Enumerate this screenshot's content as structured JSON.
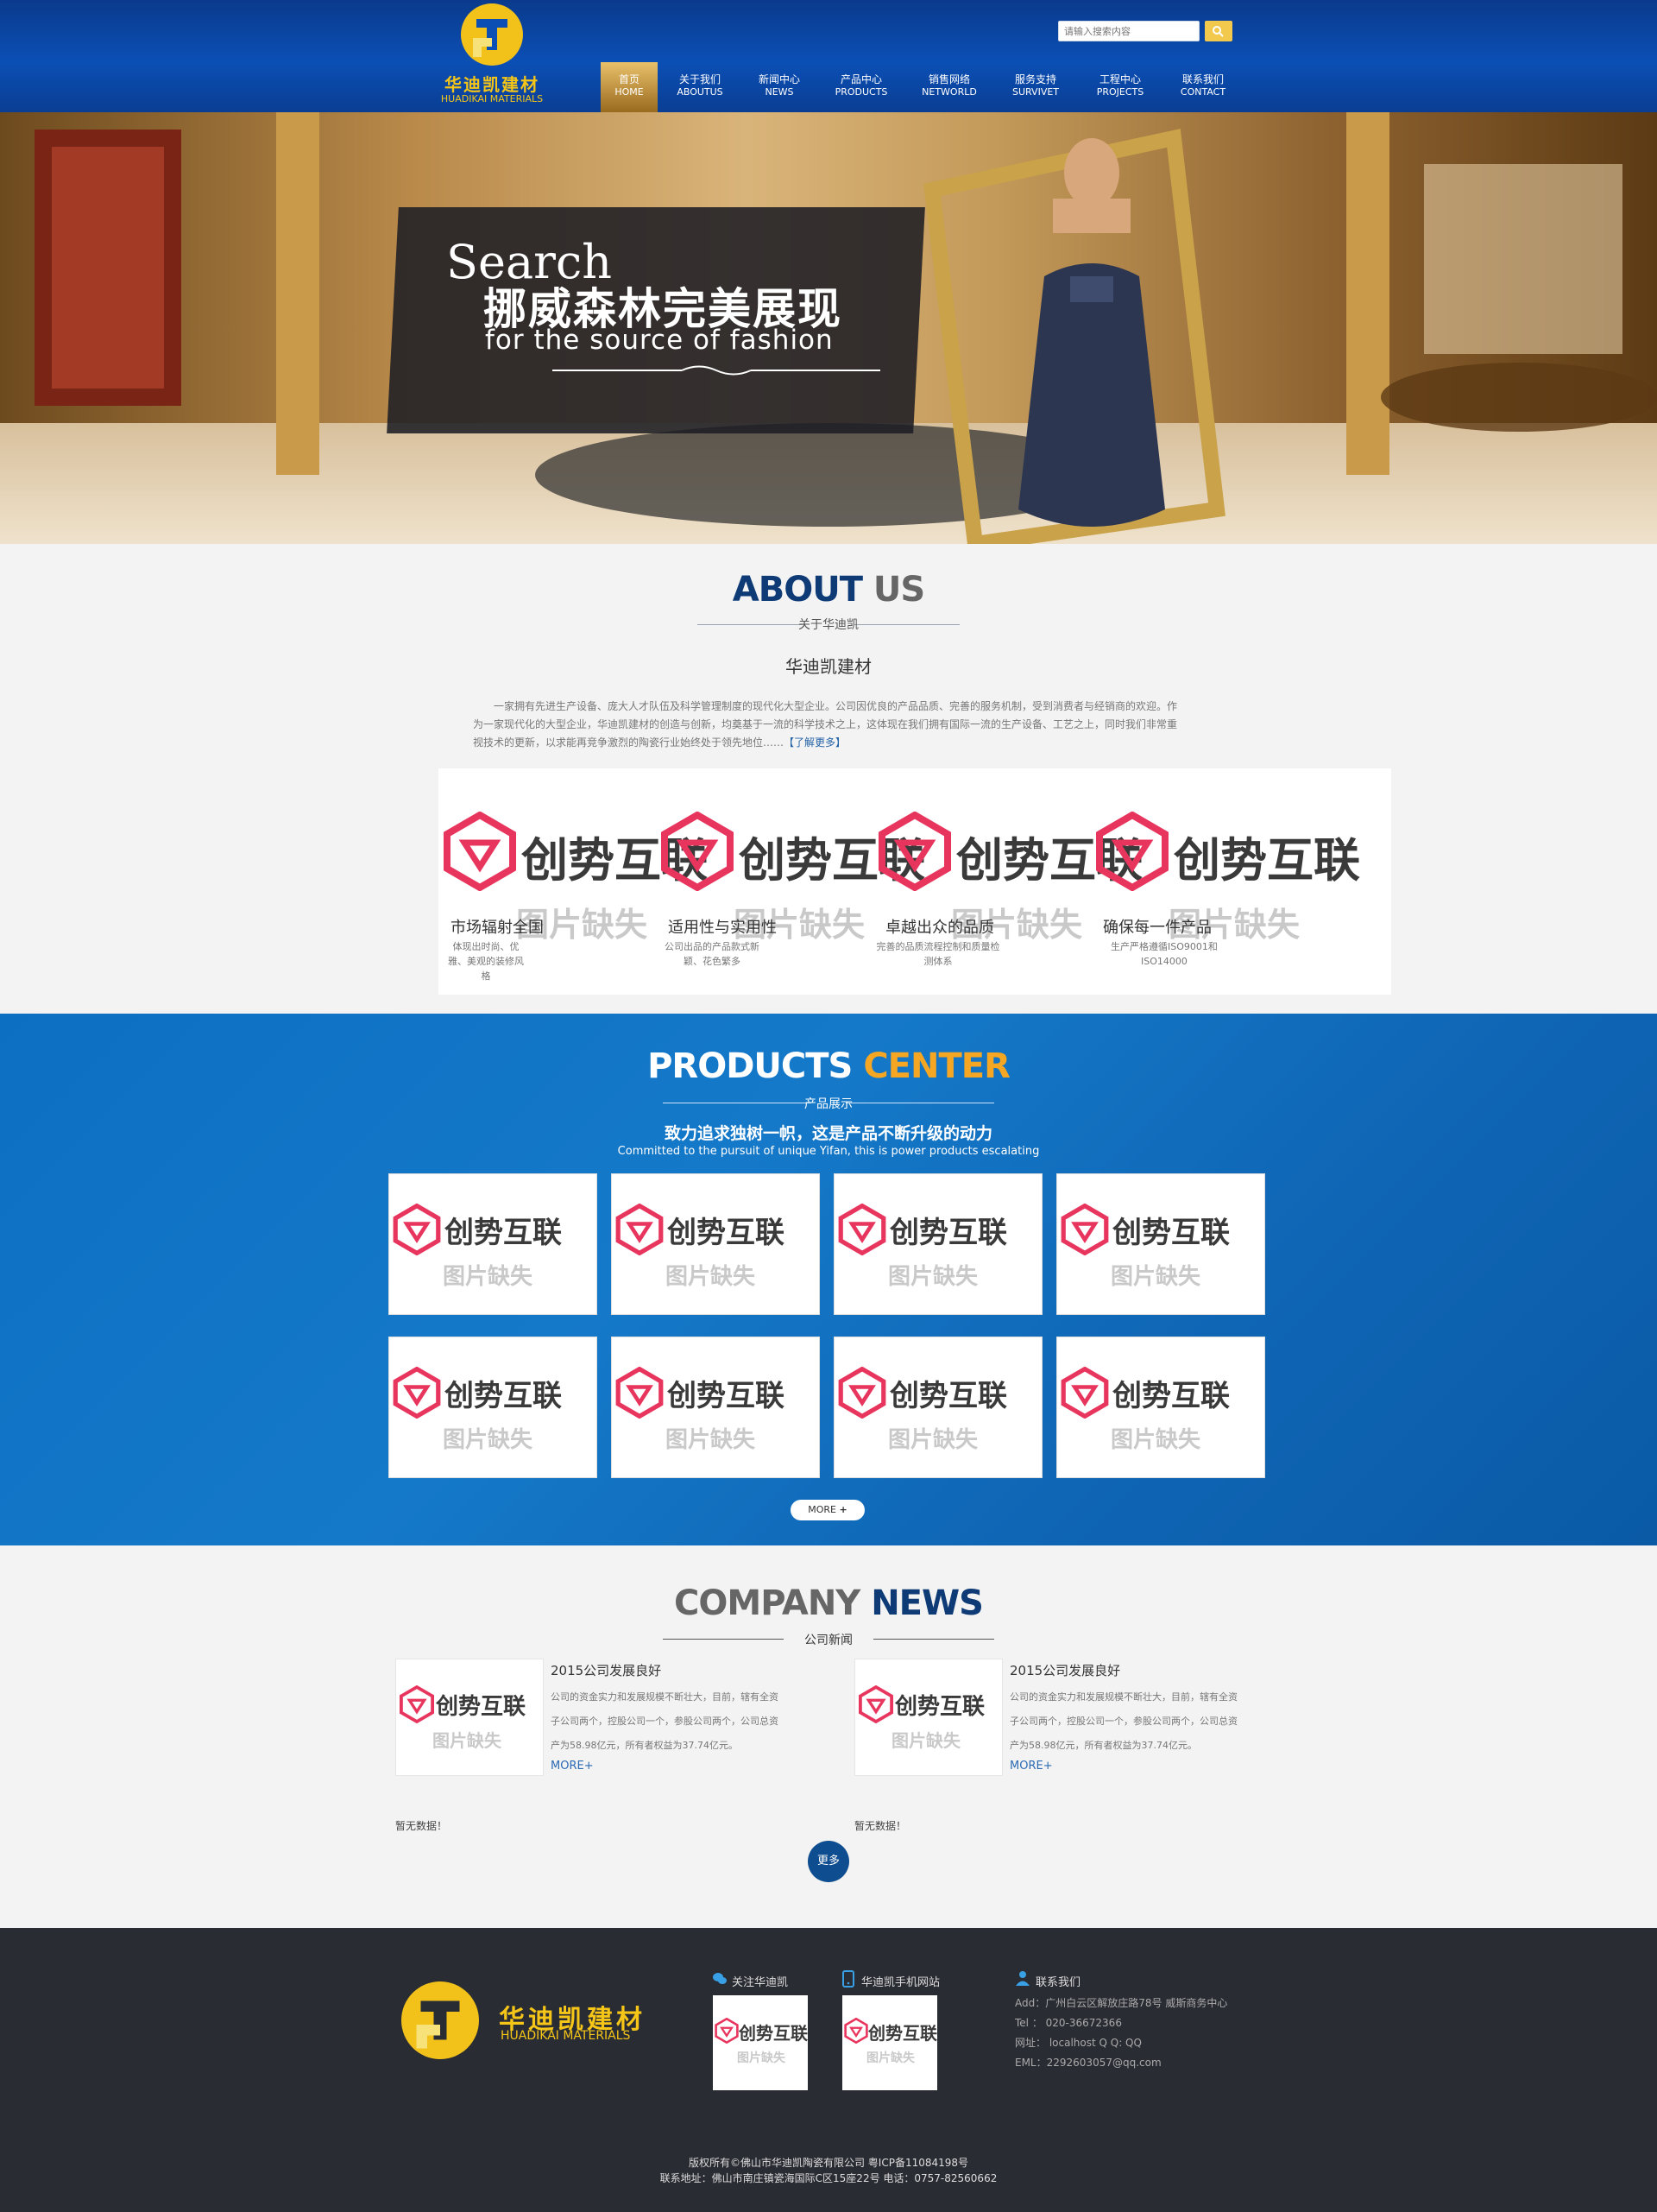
{
  "header": {
    "logo_cn": "华迪凯建材",
    "logo_en": "HUADIKAI MATERIALS",
    "search_placeholder": "请输入搜索内容",
    "nav": [
      {
        "cn": "首页",
        "en": "HOME"
      },
      {
        "cn": "关于我们",
        "en": "ABOUTUS"
      },
      {
        "cn": "新闻中心",
        "en": "NEWS"
      },
      {
        "cn": "产品中心",
        "en": "PRODUCTS"
      },
      {
        "cn": "销售网络",
        "en": "NETWORLD"
      },
      {
        "cn": "服务支持",
        "en": "SURVIVET"
      },
      {
        "cn": "工程中心",
        "en": "PROJECTS"
      },
      {
        "cn": "联系我们",
        "en": "CONTACT"
      }
    ]
  },
  "banner": {
    "word": "Search",
    "cn": "挪威森林完美展现",
    "en": "for the source of fashion"
  },
  "placeholder": {
    "brand": "创势互联",
    "missing": "图片缺失"
  },
  "about": {
    "title_a": "ABOUT",
    "title_b": "US",
    "subtitle": "关于华迪凯",
    "company": "华迪凯建材",
    "desc": "一家拥有先进生产设备、庞大人才队伍及科学管理制度的现代化大型企业。公司因优良的产品品质、完善的服务机制，受到消费者与经销商的欢迎。作为一家现代化的大型企业，华迪凯建材的创造与创新，均奠基于一流的科学技术之上，这体现在我们拥有国际一流的生产设备、工艺之上，同时我们非常重视技术的更新，以求能再竞争激烈的陶瓷行业始终处于领先地位……",
    "more": "【了解更多】",
    "features": [
      {
        "title": "市场辐射全国",
        "desc": "体现出时尚、优雅、美观的装修风格"
      },
      {
        "title": "适用性与实用性",
        "desc": "公司出品的产品款式新颖、花色繁多"
      },
      {
        "title": "卓越出众的品质",
        "desc": "完善的品质流程控制和质量检测体系"
      },
      {
        "title": "确保每一件产品",
        "desc": "生产严格遵循ISO9001和ISO14000"
      }
    ]
  },
  "products": {
    "title_a": "PRODUCTS",
    "title_b": "CENTER",
    "subtitle": "产品展示",
    "slogan_cn": "致力追求独树一帜，这是产品不断升级的动力",
    "slogan_en": "Committed to the pursuit of unique Yifan, this is power products escalating",
    "more": "MORE"
  },
  "news": {
    "title_a": "COMPANY",
    "title_b": "NEWS",
    "subtitle": "公司新闻",
    "items": [
      {
        "title": "2015公司发展良好",
        "lines": [
          "公司的资金实力和发展规模不断壮大，目前，辖有全资",
          "子公司两个，控股公司一个，参股公司两个，公司总资",
          "产为58.98亿元，所有者权益为37.74亿元。"
        ],
        "more": "MORE+"
      },
      {
        "title": "2015公司发展良好",
        "lines": [
          "公司的资金实力和发展规模不断壮大，目前，辖有全资",
          "子公司两个，控股公司一个，参股公司两个，公司总资",
          "产为58.98亿元，所有者权益为37.74亿元。"
        ],
        "more": "MORE+"
      }
    ],
    "nodata": "暂无数据！",
    "more": "更多"
  },
  "footer": {
    "logo_cn": "华迪凯建材",
    "logo_en": "HUADIKAI MATERIALS",
    "follow": "关注华迪凯",
    "mobile": "华迪凯手机网站",
    "contact": "联系我们",
    "add": "Add：广州白云区解放庄路78号 威斯商务中心",
    "tel": "Tel ： 020-36672366",
    "web": "网址： localhost Q Q: QQ",
    "eml": "EML：2292603057@qq.com",
    "copyright": "版权所有©佛山市华迪凯陶瓷有限公司 粤ICP备11084198号",
    "address": "联系地址：佛山市南庄镇瓷海国际C区15座22号   电话：0757-82560662"
  },
  "colors": {
    "header": "#0b4fb5",
    "products_bg": "#1579c9",
    "accent_gold": "#f5a623",
    "title_navy": "#0e3a75",
    "footer": "#2a2c33"
  }
}
